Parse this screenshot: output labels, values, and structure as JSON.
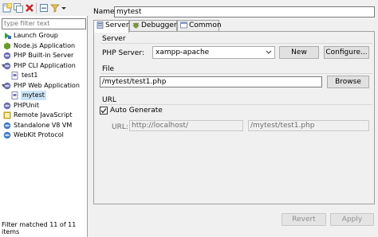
{
  "left": {
    "filter_placeholder": "type filter text",
    "tree": [
      {
        "label": "Launch Group",
        "icon": "launch-group-icon",
        "level": 0
      },
      {
        "label": "Node.js Application",
        "icon": "nodejs-icon",
        "level": 0
      },
      {
        "label": "PHP Built-in Server",
        "icon": "php-server-icon",
        "level": 0
      },
      {
        "label": "PHP CLI Application",
        "icon": "php-cli-icon",
        "level": 0,
        "expanded": true
      },
      {
        "label": "test1",
        "icon": "php-file-icon",
        "level": 1
      },
      {
        "label": "PHP Web Application",
        "icon": "php-web-icon",
        "level": 0,
        "expanded": true
      },
      {
        "label": "mytest",
        "icon": "php-file-icon",
        "level": 1,
        "selected": true
      },
      {
        "label": "PHPUnit",
        "icon": "phpunit-icon",
        "level": 0
      },
      {
        "label": "Remote JavaScript",
        "icon": "remote-js-icon",
        "level": 0
      },
      {
        "label": "Standalone V8 VM",
        "icon": "v8-icon",
        "level": 0
      },
      {
        "label": "WebKit Protocol",
        "icon": "webkit-icon",
        "level": 0
      }
    ],
    "status": "Filter matched 11 of 11 items"
  },
  "right": {
    "name_label": "Name:",
    "name_value": "mytest",
    "tabs": [
      {
        "label": "Server",
        "icon": "server-icon",
        "active": true
      },
      {
        "label": "Debugger",
        "icon": "debugger-icon"
      },
      {
        "label": "Common",
        "icon": "common-icon"
      }
    ],
    "server_group": {
      "title": "Server",
      "php_server_label": "PHP Server:",
      "php_server_value": "xampp-apache",
      "new_label": "New",
      "configure_label": "Configure..."
    },
    "file_group": {
      "title": "File",
      "file_value": "/mytest/test1.php",
      "browse_label": "Browse"
    },
    "url_group": {
      "title": "URL",
      "auto_generate_label": "Auto Generate",
      "auto_generate_checked": true,
      "url_label": "URL:",
      "url_base": "http://localhost/",
      "url_path": "/mytest/test1.php"
    },
    "revert_label": "Revert",
    "apply_label": "Apply"
  }
}
